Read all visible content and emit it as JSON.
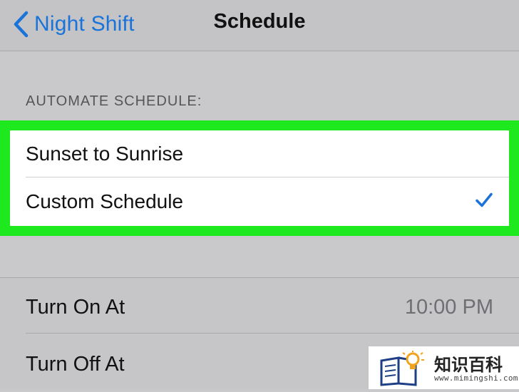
{
  "navbar": {
    "back_label": "Night Shift",
    "title": "Schedule"
  },
  "automate": {
    "header": "AUTOMATE SCHEDULE:",
    "options": [
      {
        "label": "Sunset to Sunrise",
        "selected": false
      },
      {
        "label": "Custom Schedule",
        "selected": true
      }
    ]
  },
  "times": {
    "rows": [
      {
        "label": "Turn On At",
        "value": "10:00 PM"
      },
      {
        "label": "Turn Off At",
        "value": ""
      }
    ]
  },
  "watermark": {
    "title": "知识百科",
    "url": "www.mimingshi.com"
  },
  "colors": {
    "accent": "#1a73d9",
    "highlight": "#1ee81e",
    "background": "#c9c9cc"
  },
  "icons": {
    "back": "chevron-left-icon",
    "selected": "checkmark-icon",
    "logo": "book-lightbulb-icon"
  }
}
